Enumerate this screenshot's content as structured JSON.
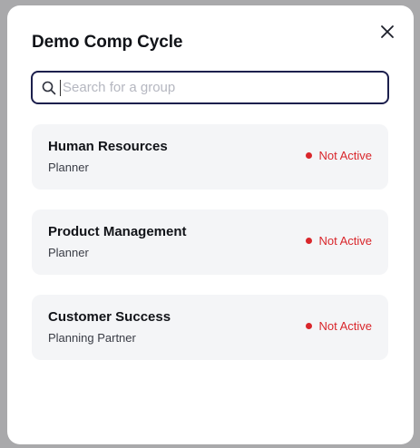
{
  "modal": {
    "title": "Demo Comp Cycle"
  },
  "search": {
    "placeholder": "Search for a group",
    "value": ""
  },
  "groups": [
    {
      "name": "Human Resources",
      "role": "Planner",
      "status": "Not Active"
    },
    {
      "name": "Product Management",
      "role": "Planner",
      "status": "Not Active"
    },
    {
      "name": "Customer Success",
      "role": "Planning Partner",
      "status": "Not Active"
    }
  ],
  "colors": {
    "status_inactive": "#d9262b",
    "search_border": "#1c1f4d",
    "card_bg": "#f4f5f7"
  },
  "icons": {
    "close": "close-icon",
    "search": "search-icon"
  }
}
